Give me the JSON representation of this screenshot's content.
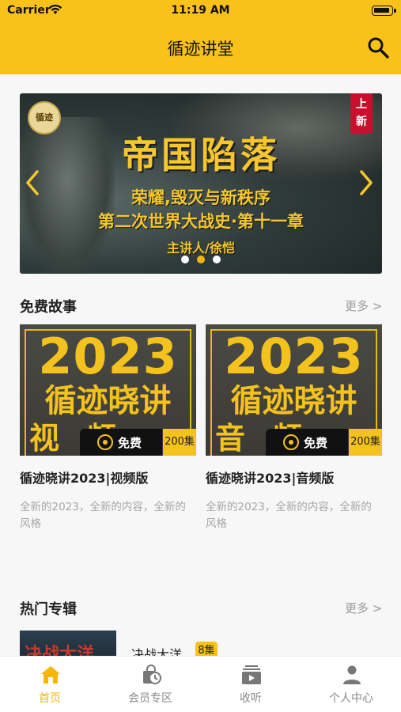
{
  "status_bar": {
    "carrier": "Carrier",
    "time": "11:19 AM"
  },
  "nav": {
    "title": "循迹讲堂",
    "search_icon": "search-icon"
  },
  "banner": {
    "logo_text": "循迹",
    "new_tag_top": "上",
    "new_tag_bottom": "新",
    "headline": "帝国陷落",
    "subtitle_1": "荣耀,毁灭与新秩序",
    "subtitle_2": "第二次世界大战史·第十一章",
    "lecturer": "主讲人/徐恺",
    "dots": 3,
    "active_dot": 1,
    "accent_color": "#f5c72c"
  },
  "free_stories": {
    "title": "免费故事",
    "more": "更多 >",
    "items": [
      {
        "cover_year": "2023",
        "cover_line": "循迹晓讲",
        "cover_format": "视频版",
        "free_label": "免费",
        "episodes": "200集",
        "name": "循迹晓讲2023|视频版",
        "desc": "全新的2023，全新的内容，全新的风格"
      },
      {
        "cover_year": "2023",
        "cover_line": "循迹晓讲",
        "cover_format": "音频版",
        "free_label": "免费",
        "episodes": "200集",
        "name": "循迹晓讲2023|音频版",
        "desc": "全新的2023，全新的内容，全新的风格"
      }
    ]
  },
  "hot_albums": {
    "title": "热门专辑",
    "more": "更多 >",
    "items": [
      {
        "cover_text": "决战大洋",
        "name": "决战大洋",
        "count": "8集"
      }
    ]
  },
  "tabbar": {
    "active_color": "#f5b50a",
    "items": [
      {
        "label": "首页",
        "icon": "home-icon"
      },
      {
        "label": "会员专区",
        "icon": "member-bag-icon"
      },
      {
        "label": "收听",
        "icon": "listen-tv-icon"
      },
      {
        "label": "个人中心",
        "icon": "person-icon"
      }
    ]
  }
}
